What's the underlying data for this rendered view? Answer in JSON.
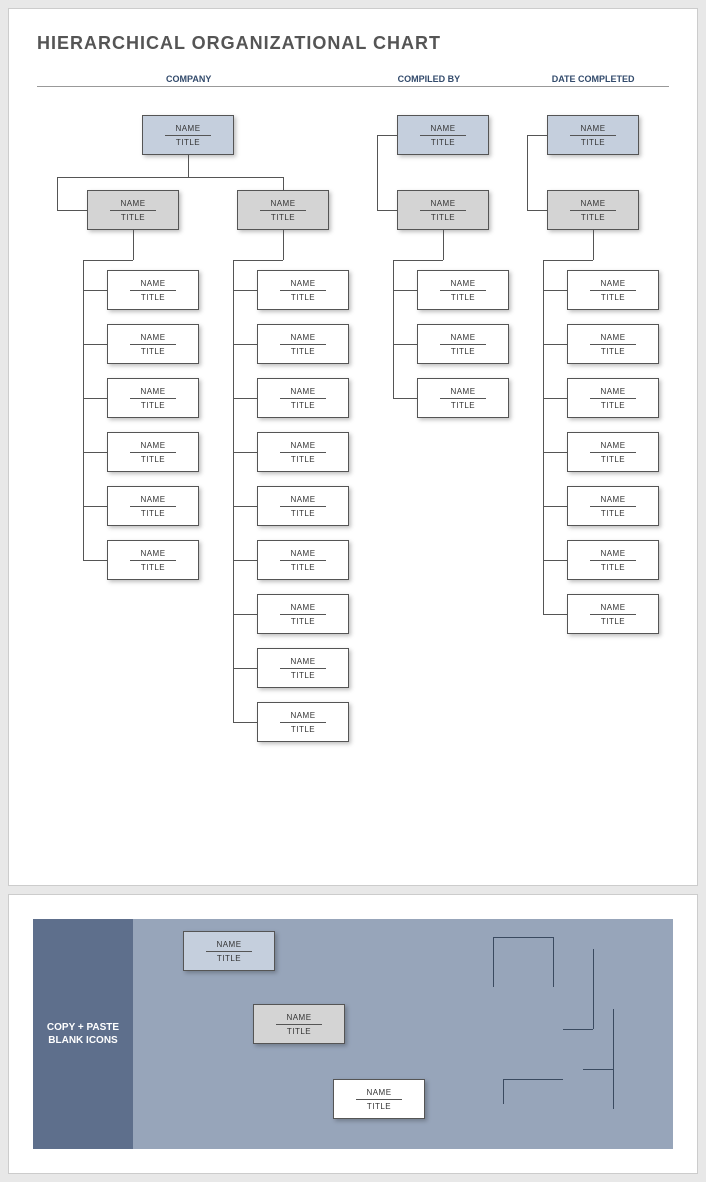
{
  "title": "HIERARCHICAL ORGANIZATIONAL CHART",
  "headers": {
    "company": "COMPANY",
    "compiled_by": "COMPILED BY",
    "date_completed": "DATE COMPLETED"
  },
  "label": {
    "name": "NAME",
    "title": "TITLE"
  },
  "panel": {
    "heading": "COPY + PASTE BLANK ICONS",
    "samples": [
      {
        "name": "NAME",
        "title": "TITLE",
        "class": "blue"
      },
      {
        "name": "NAME",
        "title": "TITLE",
        "class": "grey"
      },
      {
        "name": "NAME",
        "title": "TITLE",
        "class": "white"
      }
    ]
  },
  "chart": {
    "top": [
      {
        "id": "A1",
        "col": 1,
        "name": "NAME",
        "title": "TITLE"
      },
      {
        "id": "A3",
        "col": 3,
        "name": "NAME",
        "title": "TITLE"
      },
      {
        "id": "A4",
        "col": 4,
        "name": "NAME",
        "title": "TITLE"
      }
    ],
    "managers": [
      {
        "id": "B1",
        "col": 1,
        "name": "NAME",
        "title": "TITLE"
      },
      {
        "id": "B2",
        "col": 2,
        "name": "NAME",
        "title": "TITLE"
      },
      {
        "id": "B3",
        "col": 3,
        "name": "NAME",
        "title": "TITLE"
      },
      {
        "id": "B4",
        "col": 4,
        "name": "NAME",
        "title": "TITLE"
      }
    ],
    "staff": {
      "1": [
        {
          "name": "NAME",
          "title": "TITLE"
        },
        {
          "name": "NAME",
          "title": "TITLE"
        },
        {
          "name": "NAME",
          "title": "TITLE"
        },
        {
          "name": "NAME",
          "title": "TITLE"
        },
        {
          "name": "NAME",
          "title": "TITLE"
        },
        {
          "name": "NAME",
          "title": "TITLE"
        }
      ],
      "2": [
        {
          "name": "NAME",
          "title": "TITLE"
        },
        {
          "name": "NAME",
          "title": "TITLE"
        },
        {
          "name": "NAME",
          "title": "TITLE"
        },
        {
          "name": "NAME",
          "title": "TITLE"
        },
        {
          "name": "NAME",
          "title": "TITLE"
        },
        {
          "name": "NAME",
          "title": "TITLE"
        },
        {
          "name": "NAME",
          "title": "TITLE"
        },
        {
          "name": "NAME",
          "title": "TITLE"
        },
        {
          "name": "NAME",
          "title": "TITLE"
        }
      ],
      "3": [
        {
          "name": "NAME",
          "title": "TITLE"
        },
        {
          "name": "NAME",
          "title": "TITLE"
        },
        {
          "name": "NAME",
          "title": "TITLE"
        }
      ],
      "4": [
        {
          "name": "NAME",
          "title": "TITLE"
        },
        {
          "name": "NAME",
          "title": "TITLE"
        },
        {
          "name": "NAME",
          "title": "TITLE"
        },
        {
          "name": "NAME",
          "title": "TITLE"
        },
        {
          "name": "NAME",
          "title": "TITLE"
        },
        {
          "name": "NAME",
          "title": "TITLE"
        },
        {
          "name": "NAME",
          "title": "TITLE"
        }
      ]
    }
  }
}
